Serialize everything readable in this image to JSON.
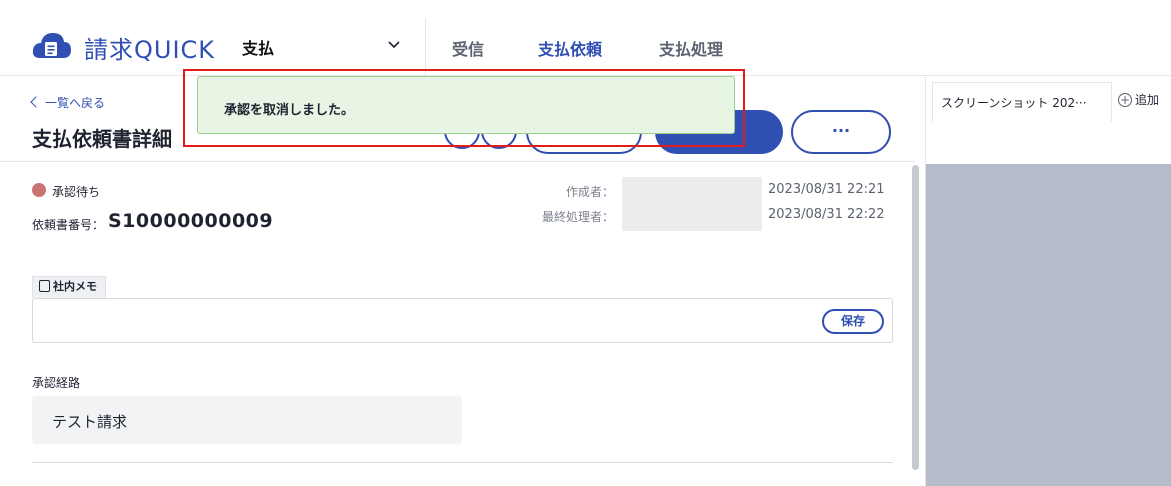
{
  "app": {
    "name": "請求QUICK",
    "module_select": "支払"
  },
  "nav": {
    "items": [
      {
        "label": "受信"
      },
      {
        "label": "支払依頼"
      },
      {
        "label": "支払処理"
      }
    ],
    "active": "支払依頼"
  },
  "page": {
    "back_link": "一覧へ戻る",
    "title": "支払依頼書詳細",
    "more_label": "···"
  },
  "status": {
    "label": "承認待ち",
    "color": "#c97373"
  },
  "request": {
    "number_label": "依頼書番号：",
    "number": "S10000000009"
  },
  "meta": {
    "creator_label": "作成者：",
    "creator_date": "2023/08/31 22:21",
    "last_label": "最終処理者：",
    "last_date": "2023/08/31 22:22"
  },
  "memo": {
    "tag": "社内メモ",
    "value": "",
    "save_label": "保存"
  },
  "route": {
    "label": "承認経路",
    "value": "テスト請求"
  },
  "attachments": {
    "tab_label": "スクリーンショット 202···",
    "add_label": "追加"
  },
  "toast": {
    "message": "承認を取消しました。"
  },
  "colors": {
    "brand": "#2f4fb3",
    "toast_bg": "#e8f4e4",
    "highlight": "#e31b1b"
  }
}
